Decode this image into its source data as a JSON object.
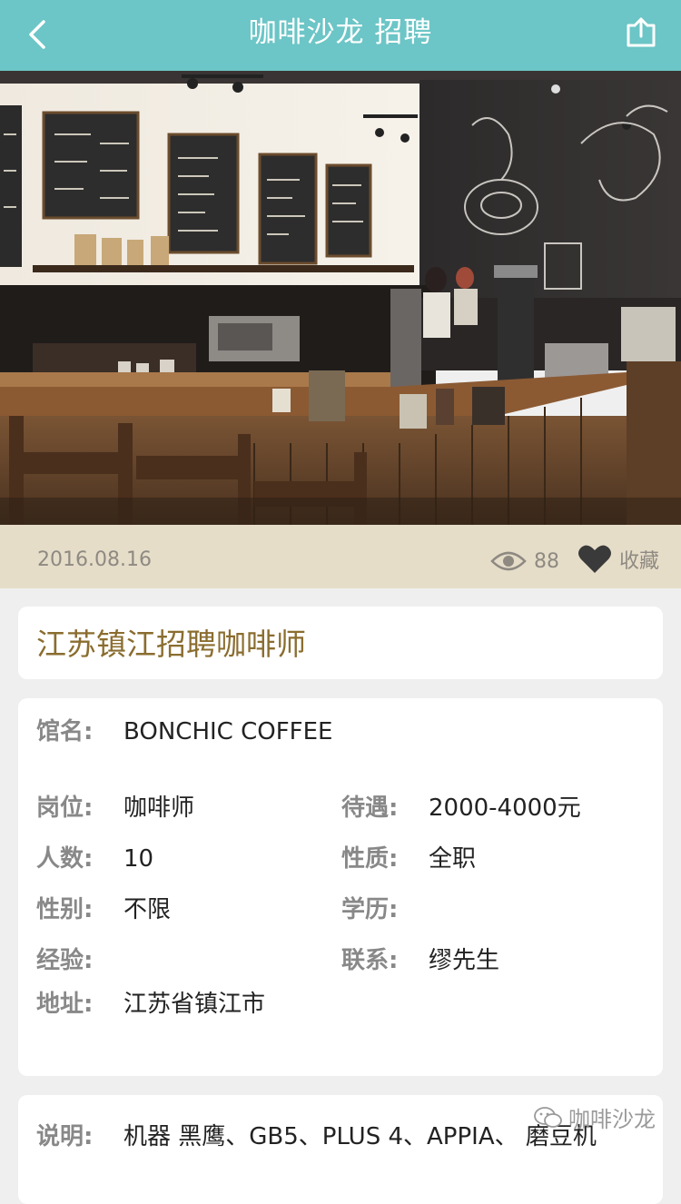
{
  "header": {
    "title": "咖啡沙龙 招聘",
    "back_icon": "chevron-left-icon",
    "share_icon": "share-icon"
  },
  "hero": {
    "description_icon": "cafe-photo"
  },
  "meta": {
    "date": "2016.08.16",
    "views": "88",
    "favorite_label": "收藏",
    "eye_icon": "eye-icon",
    "heart_icon": "heart-icon"
  },
  "job": {
    "title": "江苏镇江招聘咖啡师"
  },
  "details": {
    "venue_label": "馆名:",
    "venue": "BONCHIC COFFEE",
    "position_label": "岗位:",
    "position": "咖啡师",
    "salary_label": "待遇:",
    "salary": "2000-4000元",
    "headcount_label": "人数:",
    "headcount": "10",
    "type_label": "性质:",
    "type": "全职",
    "gender_label": "性别:",
    "gender": "不限",
    "education_label": "学历:",
    "education": "",
    "experience_label": "经验:",
    "experience": "",
    "contact_label": "联系:",
    "contact": "缪先生",
    "address_label": "地址:",
    "address": "江苏省镇江市"
  },
  "description": {
    "label": "说明:",
    "text": "机器 黑鹰、GB5、PLUS 4、APPIA、 磨豆机"
  },
  "watermark": {
    "text": "咖啡沙龙"
  },
  "colors": {
    "header_bg": "#6cc5c6",
    "meta_bg": "#e6ddc9",
    "title_color": "#8a6d2f",
    "page_bg": "#efefef"
  }
}
